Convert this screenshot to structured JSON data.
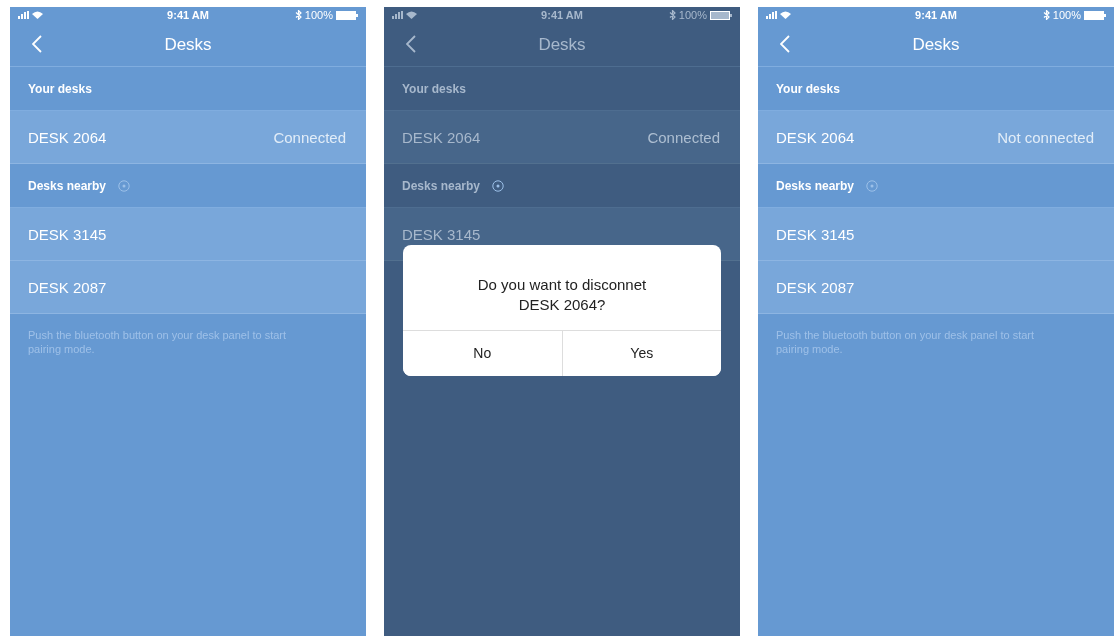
{
  "screens": [
    {
      "status_bar": {
        "time": "9:41 AM",
        "battery": "100%"
      },
      "title": "Desks",
      "your_desks": {
        "heading": "Your desks",
        "desks": [
          {
            "name": "DESK 2064",
            "status": "Connected"
          }
        ]
      },
      "nearby": {
        "heading": "Desks nearby",
        "desks": [
          {
            "name": "DESK 3145"
          },
          {
            "name": "DESK 2087"
          }
        ]
      },
      "hint": "Push the bluetooth button on your desk panel to start pairing mode."
    },
    {
      "status_bar": {
        "time": "9:41 AM",
        "battery": "100%"
      },
      "title": "Desks",
      "your_desks": {
        "heading": "Your desks",
        "desks": [
          {
            "name": "DESK 2064",
            "status": "Connected"
          }
        ]
      },
      "nearby": {
        "heading": "Desks nearby",
        "desks": [
          {
            "name": "DESK 3145"
          }
        ]
      },
      "dialog": {
        "message": "Do you want to disconnet DESK 2064?",
        "buttons": [
          "No",
          "Yes"
        ]
      }
    },
    {
      "status_bar": {
        "time": "9:41 AM",
        "battery": "100%"
      },
      "title": "Desks",
      "your_desks": {
        "heading": "Your desks",
        "desks": [
          {
            "name": "DESK 2064",
            "status": "Not connected"
          }
        ]
      },
      "nearby": {
        "heading": "Desks nearby",
        "desks": [
          {
            "name": "DESK 3145"
          },
          {
            "name": "DESK 2087"
          }
        ]
      },
      "hint": "Push the bluetooth button on your desk panel to start pairing mode."
    }
  ]
}
